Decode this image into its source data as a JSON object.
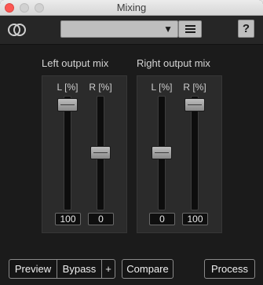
{
  "window": {
    "title": "Mixing"
  },
  "toolbar": {
    "link_icon": "linked-rings-icon",
    "preset_value": "",
    "dropdown_arrow": "▼",
    "help_label": "?"
  },
  "groups": [
    {
      "title": "Left output mix",
      "channels": [
        {
          "label": "L [%]",
          "value": "100",
          "level": 1.0
        },
        {
          "label": "R [%]",
          "value": "0",
          "level": 0.0
        }
      ]
    },
    {
      "title": "Right output mix",
      "channels": [
        {
          "label": "L [%]",
          "value": "0",
          "level": 0.0
        },
        {
          "label": "R [%]",
          "value": "100",
          "level": 1.0
        }
      ]
    }
  ],
  "footer": {
    "preview_label": "Preview",
    "bypass_label": "Bypass",
    "plus_label": "+",
    "compare_label": "Compare",
    "process_label": "Process"
  }
}
